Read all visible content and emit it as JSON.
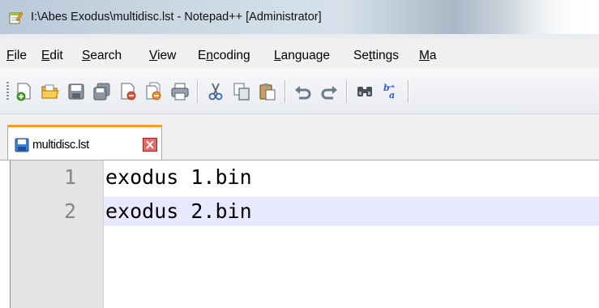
{
  "window": {
    "title": "I:\\Abes Exodus\\multidisc.lst - Notepad++ [Administrator]",
    "icon": "notepad-plus-plus-icon"
  },
  "menu": [
    {
      "label": "File",
      "underline": "F",
      "rest": "ile"
    },
    {
      "label": "Edit",
      "underline": "E",
      "rest": "dit"
    },
    {
      "label": "Search",
      "underline": "S",
      "rest": "earch"
    },
    {
      "label": "View",
      "underline": "V",
      "rest": "iew"
    },
    {
      "label": "Encoding",
      "pre": "E",
      "underline": "n",
      "rest": "coding"
    },
    {
      "label": "Language",
      "underline": "L",
      "rest": "anguage"
    },
    {
      "label": "Settings",
      "pre": "Se",
      "underline": "t",
      "rest": "tings"
    },
    {
      "label": "Ma",
      "underline": "M",
      "rest": "a"
    }
  ],
  "toolbar": [
    "new-file-icon",
    "open-file-icon",
    "save-icon",
    "save-all-icon",
    "close-icon",
    "close-all-icon",
    "print-icon",
    "cut-icon",
    "copy-icon",
    "paste-icon",
    "undo-icon",
    "redo-icon",
    "find-icon",
    "replace-icon"
  ],
  "tab": {
    "label": "multidisc.lst",
    "active_color": "#fa9b2d"
  },
  "editor": {
    "current_line_color": "#e8e8ff",
    "lines": [
      {
        "number": "1",
        "text": "exodus 1.bin"
      },
      {
        "number": "2",
        "text": "exodus 2.bin"
      }
    ]
  }
}
